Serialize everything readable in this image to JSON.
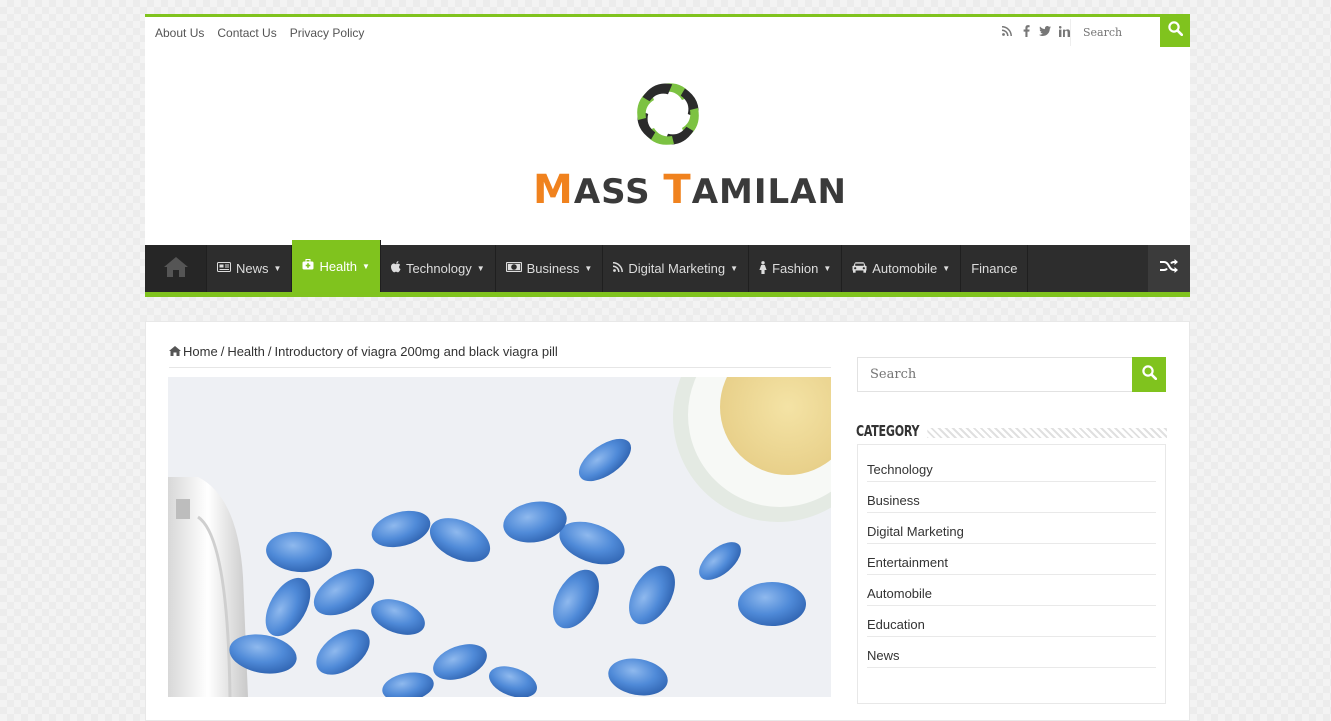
{
  "topbar": {
    "links": [
      "About Us",
      "Contact Us",
      "Privacy Policy"
    ],
    "social_icons": [
      "rss-icon",
      "facebook-icon",
      "twitter-icon",
      "linkedin-icon"
    ],
    "search_placeholder": "Search"
  },
  "logo": {
    "text_first_initial": "M",
    "text_first_rest": "ASS ",
    "text_second_initial": "T",
    "text_second_rest": "AMILAN",
    "alt": "Mass Tamilan"
  },
  "nav": {
    "items": [
      {
        "label": "News",
        "icon": "newspaper-icon",
        "has_dropdown": true
      },
      {
        "label": "Health",
        "icon": "medkit-icon",
        "has_dropdown": true,
        "active": true
      },
      {
        "label": "Technology",
        "icon": "apple-icon",
        "has_dropdown": true
      },
      {
        "label": "Business",
        "icon": "money-icon",
        "has_dropdown": true
      },
      {
        "label": "Digital Marketing",
        "icon": "rss-icon",
        "has_dropdown": true
      },
      {
        "label": "Fashion",
        "icon": "female-icon",
        "has_dropdown": true
      },
      {
        "label": "Automobile",
        "icon": "car-icon",
        "has_dropdown": true
      },
      {
        "label": "Finance",
        "icon": "",
        "has_dropdown": false
      }
    ]
  },
  "breadcrumb": {
    "home": "Home",
    "sep1": "/",
    "category": "Health",
    "sep2": "/",
    "current": "Introductory of viagra 200mg and black viagra pill"
  },
  "sidebar": {
    "search_placeholder": "Search",
    "category_title": "Category",
    "categories": [
      "Technology",
      "Business",
      "Digital Marketing",
      "Entertainment",
      "Automobile",
      "Education",
      "News"
    ]
  },
  "colors": {
    "accent": "#80c31e",
    "nav_bg": "#2d2d2d",
    "logo_orange": "#f0821e"
  }
}
